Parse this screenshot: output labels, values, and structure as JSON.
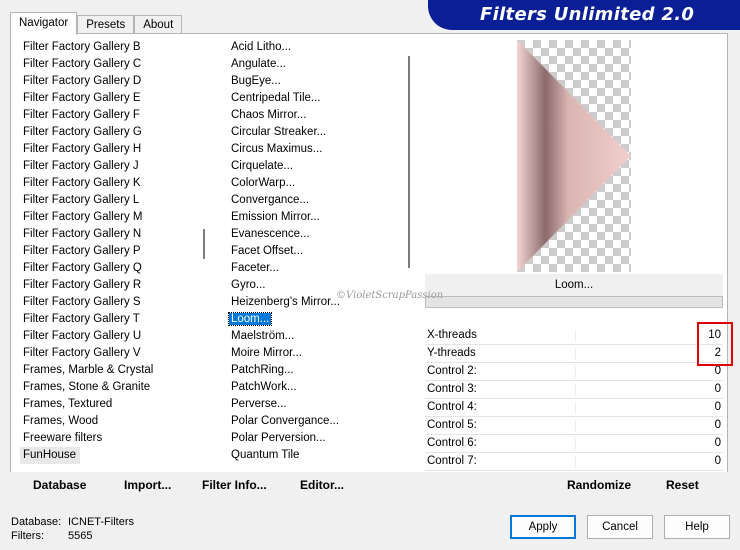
{
  "tabs": [
    "Navigator",
    "Presets",
    "About"
  ],
  "app_title": "Filters Unlimited 2.0",
  "categories": [
    "Filter Factory Gallery B",
    "Filter Factory Gallery C",
    "Filter Factory Gallery D",
    "Filter Factory Gallery E",
    "Filter Factory Gallery F",
    "Filter Factory Gallery G",
    "Filter Factory Gallery H",
    "Filter Factory Gallery J",
    "Filter Factory Gallery K",
    "Filter Factory Gallery L",
    "Filter Factory Gallery M",
    "Filter Factory Gallery N",
    "Filter Factory Gallery P",
    "Filter Factory Gallery Q",
    "Filter Factory Gallery R",
    "Filter Factory Gallery S",
    "Filter Factory Gallery T",
    "Filter Factory Gallery U",
    "Filter Factory Gallery V",
    "Frames, Marble & Crystal",
    "Frames, Stone & Granite",
    "Frames, Textured",
    "Frames, Wood",
    "Freeware filters",
    "FunHouse"
  ],
  "selected_category": "FunHouse",
  "filters": [
    "Acid Litho...",
    "Angulate...",
    "BugEye...",
    "Centripedal Tile...",
    "Chaos Mirror...",
    "Circular Streaker...",
    "Circus Maximus...",
    "Cirquelate...",
    "ColorWarp...",
    "Convergance...",
    "Emission Mirror...",
    "Evanescence...",
    "Facet Offset...",
    "Faceter...",
    "Gyro...",
    "Heizenberg's Mirror...",
    "Loom...",
    "Maelström...",
    "Moire Mirror...",
    "PatchRing...",
    "PatchWork...",
    "Perverse...",
    "Polar Convergance...",
    "Polar Perversion...",
    "Quantum Tile"
  ],
  "selected_filter": "Loom...",
  "preview_caption": "Loom...",
  "watermark": "©VioletScrapPassion",
  "controls": [
    {
      "label": "X-threads",
      "value": "10"
    },
    {
      "label": "Y-threads",
      "value": "2"
    },
    {
      "label": "Control 2:",
      "value": "0"
    },
    {
      "label": "Control 3:",
      "value": "0"
    },
    {
      "label": "Control 4:",
      "value": "0"
    },
    {
      "label": "Control 5:",
      "value": "0"
    },
    {
      "label": "Control 6:",
      "value": "0"
    },
    {
      "label": "Control 7:",
      "value": "0"
    }
  ],
  "buttons": {
    "database": "Database",
    "import": "Import...",
    "filter_info": "Filter Info...",
    "editor": "Editor...",
    "randomize": "Randomize",
    "reset": "Reset",
    "apply": "Apply",
    "cancel": "Cancel",
    "help": "Help"
  },
  "status": {
    "database_label": "Database:",
    "database_value": "ICNET-Filters",
    "filters_label": "Filters:",
    "filters_value": "5565"
  },
  "colors": {
    "banner": "#0a1e96",
    "selection": "#0078d7",
    "highlight_box": "#e00000"
  }
}
